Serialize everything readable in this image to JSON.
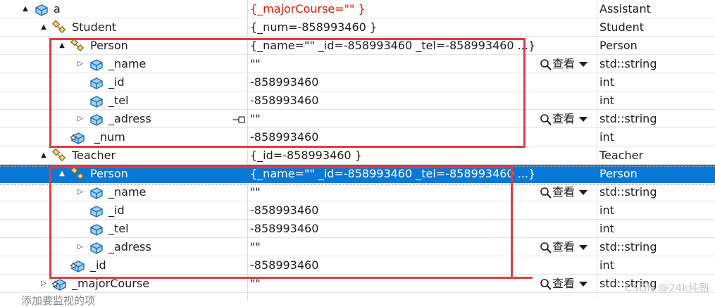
{
  "rows": [
    {
      "name": "a",
      "value": "{_majorCourse=\"\" }",
      "type": "Assistant",
      "expander": "▲",
      "icon": "class-object-icon",
      "value_color": "#e51400"
    },
    {
      "name": "Student",
      "value": "{_num=-858993460 }",
      "type": "Student",
      "expander": "▲",
      "icon": "base-class-icon"
    },
    {
      "name": "Person",
      "value": "{_name=\"\" _id=-858993460 _tel=-858993460 ...}",
      "type": "Person",
      "expander": "▲",
      "icon": "base-class-icon"
    },
    {
      "name": "_name",
      "value": "\"\"",
      "type": "std::string",
      "expander": "▷",
      "icon": "field-icon",
      "view": "查看"
    },
    {
      "name": "_id",
      "value": "-858993460",
      "type": "int",
      "icon": "field-icon"
    },
    {
      "name": "_tel",
      "value": "-858993460",
      "type": "int",
      "icon": "field-icon"
    },
    {
      "name": "_adress",
      "value": "\"\"",
      "type": "std::string",
      "expander": "▷",
      "icon": "field-icon",
      "view": "查看",
      "pinned": true
    },
    {
      "name": "_num",
      "value": "-858993460",
      "type": "int",
      "icon": "protected-field-icon"
    },
    {
      "name": "Teacher",
      "value": "{_id=-858993460 }",
      "type": "Teacher",
      "expander": "▲",
      "icon": "base-class-icon"
    },
    {
      "name": "Person",
      "value": "{_name=\"\" _id=-858993460 _tel=-858993460 ...}",
      "type": "Person",
      "expander": "▲",
      "icon": "base-class-icon",
      "selected": true
    },
    {
      "name": "_name",
      "value": "\"\"",
      "type": "std::string",
      "expander": "▷",
      "icon": "field-icon",
      "view": "查看"
    },
    {
      "name": "_id",
      "value": "-858993460",
      "type": "int",
      "icon": "field-icon"
    },
    {
      "name": "_tel",
      "value": "-858993460",
      "type": "int",
      "icon": "field-icon"
    },
    {
      "name": "_adress",
      "value": "\"\"",
      "type": "std::string",
      "expander": "▷",
      "icon": "field-icon",
      "view": "查看"
    },
    {
      "name": "_id",
      "value": "-858993460",
      "type": "int",
      "icon": "protected-field-icon"
    },
    {
      "name": "_majorCourse",
      "value": "\"\"",
      "type": "std::string",
      "expander": "▷",
      "icon": "protected-field-icon",
      "view": "查看"
    }
  ],
  "add_watch_text": "添加要监视的项",
  "watermark": "CSDN @24k纯甄",
  "colors": {
    "selection": "#0a78d7",
    "highlight_box": "#e53940",
    "changed_value": "#e51400"
  }
}
